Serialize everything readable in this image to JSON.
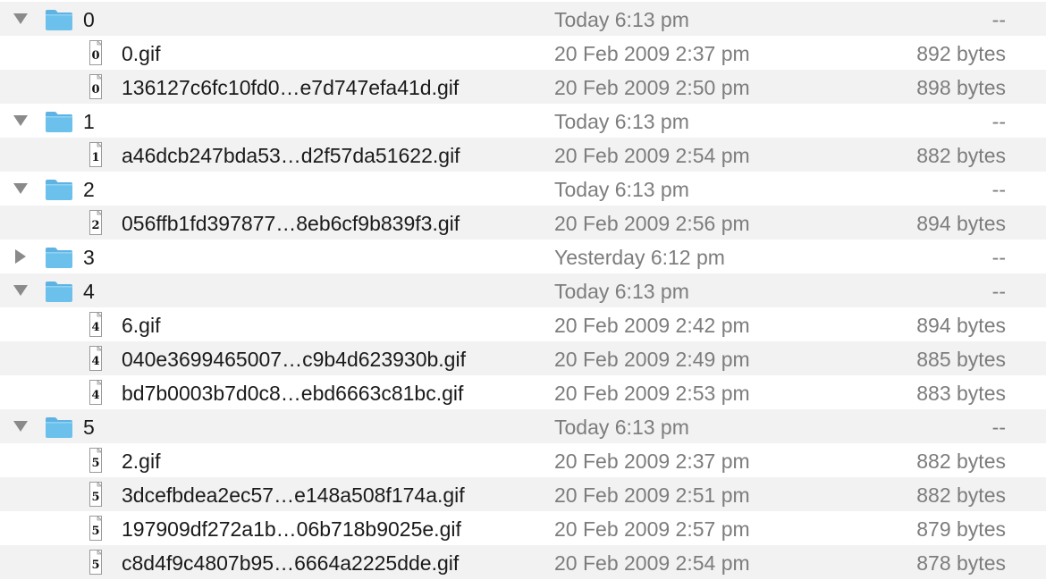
{
  "colors": {
    "row_alt": "#f2f2f2",
    "name_text": "#1a1a1a",
    "meta_text": "#7d7d7d",
    "folder_blue": "#6cc1ec"
  },
  "icons": {
    "folder": "folder-icon",
    "file": "gif-file-icon",
    "expanded": "disclosure-expanded-icon",
    "collapsed": "disclosure-collapsed-icon"
  },
  "rows": [
    {
      "type": "folder",
      "expanded": true,
      "name": "0",
      "date": "Today 6:13 pm",
      "size": "--"
    },
    {
      "type": "file",
      "badge": "0",
      "name": "0.gif",
      "date": "20 Feb 2009 2:37 pm",
      "size": "892 bytes"
    },
    {
      "type": "file",
      "badge": "0",
      "name": "136127c6fc10fd0…e7d747efa41d.gif",
      "date": "20 Feb 2009 2:50 pm",
      "size": "898 bytes"
    },
    {
      "type": "folder",
      "expanded": true,
      "name": "1",
      "date": "Today 6:13 pm",
      "size": "--"
    },
    {
      "type": "file",
      "badge": "1",
      "name": "a46dcb247bda53…d2f57da51622.gif",
      "date": "20 Feb 2009 2:54 pm",
      "size": "882 bytes"
    },
    {
      "type": "folder",
      "expanded": true,
      "name": "2",
      "date": "Today 6:13 pm",
      "size": "--"
    },
    {
      "type": "file",
      "badge": "2",
      "name": "056ffb1fd397877…8eb6cf9b839f3.gif",
      "date": "20 Feb 2009 2:56 pm",
      "size": "894 bytes"
    },
    {
      "type": "folder",
      "expanded": false,
      "name": "3",
      "date": "Yesterday 6:12 pm",
      "size": "--"
    },
    {
      "type": "folder",
      "expanded": true,
      "name": "4",
      "date": "Today 6:13 pm",
      "size": "--"
    },
    {
      "type": "file",
      "badge": "4",
      "name": "6.gif",
      "date": "20 Feb 2009 2:42 pm",
      "size": "894 bytes"
    },
    {
      "type": "file",
      "badge": "4",
      "name": "040e3699465007…c9b4d623930b.gif",
      "date": "20 Feb 2009 2:49 pm",
      "size": "885 bytes"
    },
    {
      "type": "file",
      "badge": "4",
      "name": "bd7b0003b7d0c8…ebd6663c81bc.gif",
      "date": "20 Feb 2009 2:53 pm",
      "size": "883 bytes"
    },
    {
      "type": "folder",
      "expanded": true,
      "name": "5",
      "date": "Today 6:13 pm",
      "size": "--"
    },
    {
      "type": "file",
      "badge": "5",
      "name": "2.gif",
      "date": "20 Feb 2009 2:37 pm",
      "size": "882 bytes"
    },
    {
      "type": "file",
      "badge": "5",
      "name": "3dcefbdea2ec57…e148a508f174a.gif",
      "date": "20 Feb 2009 2:51 pm",
      "size": "882 bytes"
    },
    {
      "type": "file",
      "badge": "5",
      "name": "197909df272a1b…06b718b9025e.gif",
      "date": "20 Feb 2009 2:57 pm",
      "size": "879 bytes"
    },
    {
      "type": "file",
      "badge": "5",
      "name": "c8d4f9c4807b95…6664a2225dde.gif",
      "date": "20 Feb 2009 2:54 pm",
      "size": "878 bytes"
    }
  ]
}
